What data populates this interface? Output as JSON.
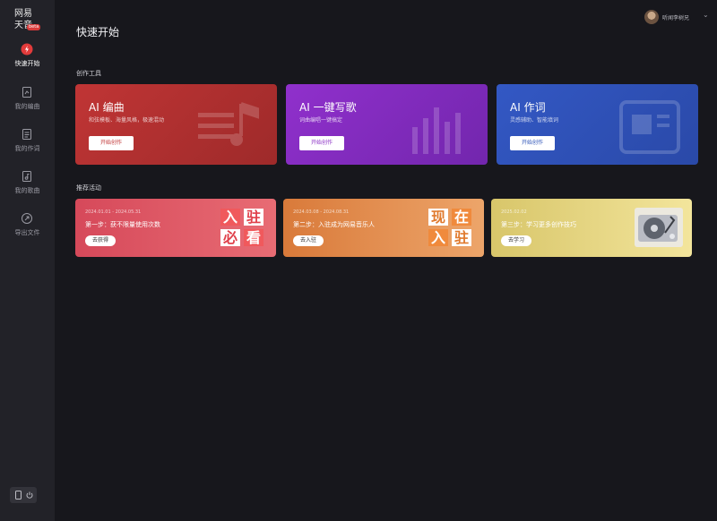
{
  "app": {
    "logo_line1": "网易",
    "logo_line2": "天音",
    "logo_badge": "beta"
  },
  "sidebar": {
    "items": [
      {
        "label": "快速开始",
        "icon": "lightning-icon",
        "active": true
      },
      {
        "label": "我的编曲",
        "icon": "arrangement-icon",
        "active": false
      },
      {
        "label": "我的作词",
        "icon": "lyrics-icon",
        "active": false
      },
      {
        "label": "我的歌曲",
        "icon": "song-icon",
        "active": false
      },
      {
        "label": "导出文件",
        "icon": "export-icon",
        "active": false
      }
    ],
    "bottom_icons": [
      "phone-icon",
      "power-icon"
    ]
  },
  "header": {
    "title": "快速开始",
    "user_name": "听闻李树兄"
  },
  "sections": {
    "tools": "创作工具",
    "activities": "推荐活动"
  },
  "tools": [
    {
      "name": "AI 编曲",
      "desc": "和弦模板、海量风格，极速混动",
      "button": "开始创作",
      "color": "#b53232",
      "icon": "music-note-icon"
    },
    {
      "name": "AI 一键写歌",
      "desc": "词曲编唱一键搞定",
      "button": "开始创作",
      "color": "#8a2fc4",
      "icon": "waveform-icon"
    },
    {
      "name": "AI 作词",
      "desc": "灵感辅助、智能填词",
      "button": "开始创作",
      "color": "#2f55b8",
      "icon": "lyrics-sheet-icon"
    }
  ],
  "activities": [
    {
      "date": "2024.01.01 - 2024.05.31",
      "title": "第一步：获不限量使用次数",
      "button": "去获得",
      "stamp": [
        "入",
        "驻",
        "必",
        "看"
      ]
    },
    {
      "date": "2024.03.08 - 2024.08.31",
      "title": "第二步：入驻成为网易音乐人",
      "button": "去入驻",
      "stamp": [
        "现",
        "在",
        "入",
        "驻"
      ]
    },
    {
      "date": "2025.02.02",
      "title": "第三步：学习更多创作技巧",
      "button": "去学习",
      "image": "turntable-image"
    }
  ]
}
